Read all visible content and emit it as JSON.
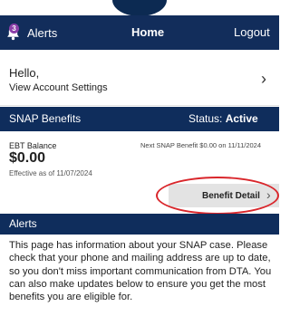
{
  "nav": {
    "alerts_label": "Alerts",
    "alerts_count": "3",
    "home_label": "Home",
    "logout_label": "Logout"
  },
  "account": {
    "greeting": "Hello,",
    "settings_link": "View Account Settings"
  },
  "snap": {
    "title": "SNAP Benefits",
    "status_label": "Status:",
    "status_value": "Active",
    "ebt_label": "EBT Balance",
    "ebt_value": "$0.00",
    "effective": "Effective as of 11/07/2024",
    "next_benefit": "Next SNAP Benefit $0.00 on 11/11/2024",
    "detail_button": "Benefit Detail"
  },
  "alerts": {
    "title": "Alerts",
    "message": "This page has information about your SNAP case. Please check that your phone and mailing address are up to date, so you don't miss important communication from DTA. You can also make updates below to ensure you get the most benefits you are eligible for."
  },
  "colors": {
    "navy": "#122d5b",
    "badge": "#8b3fa8",
    "highlight": "#d9262b"
  },
  "icons": [
    "bell-icon",
    "chevron-right-icon"
  ]
}
